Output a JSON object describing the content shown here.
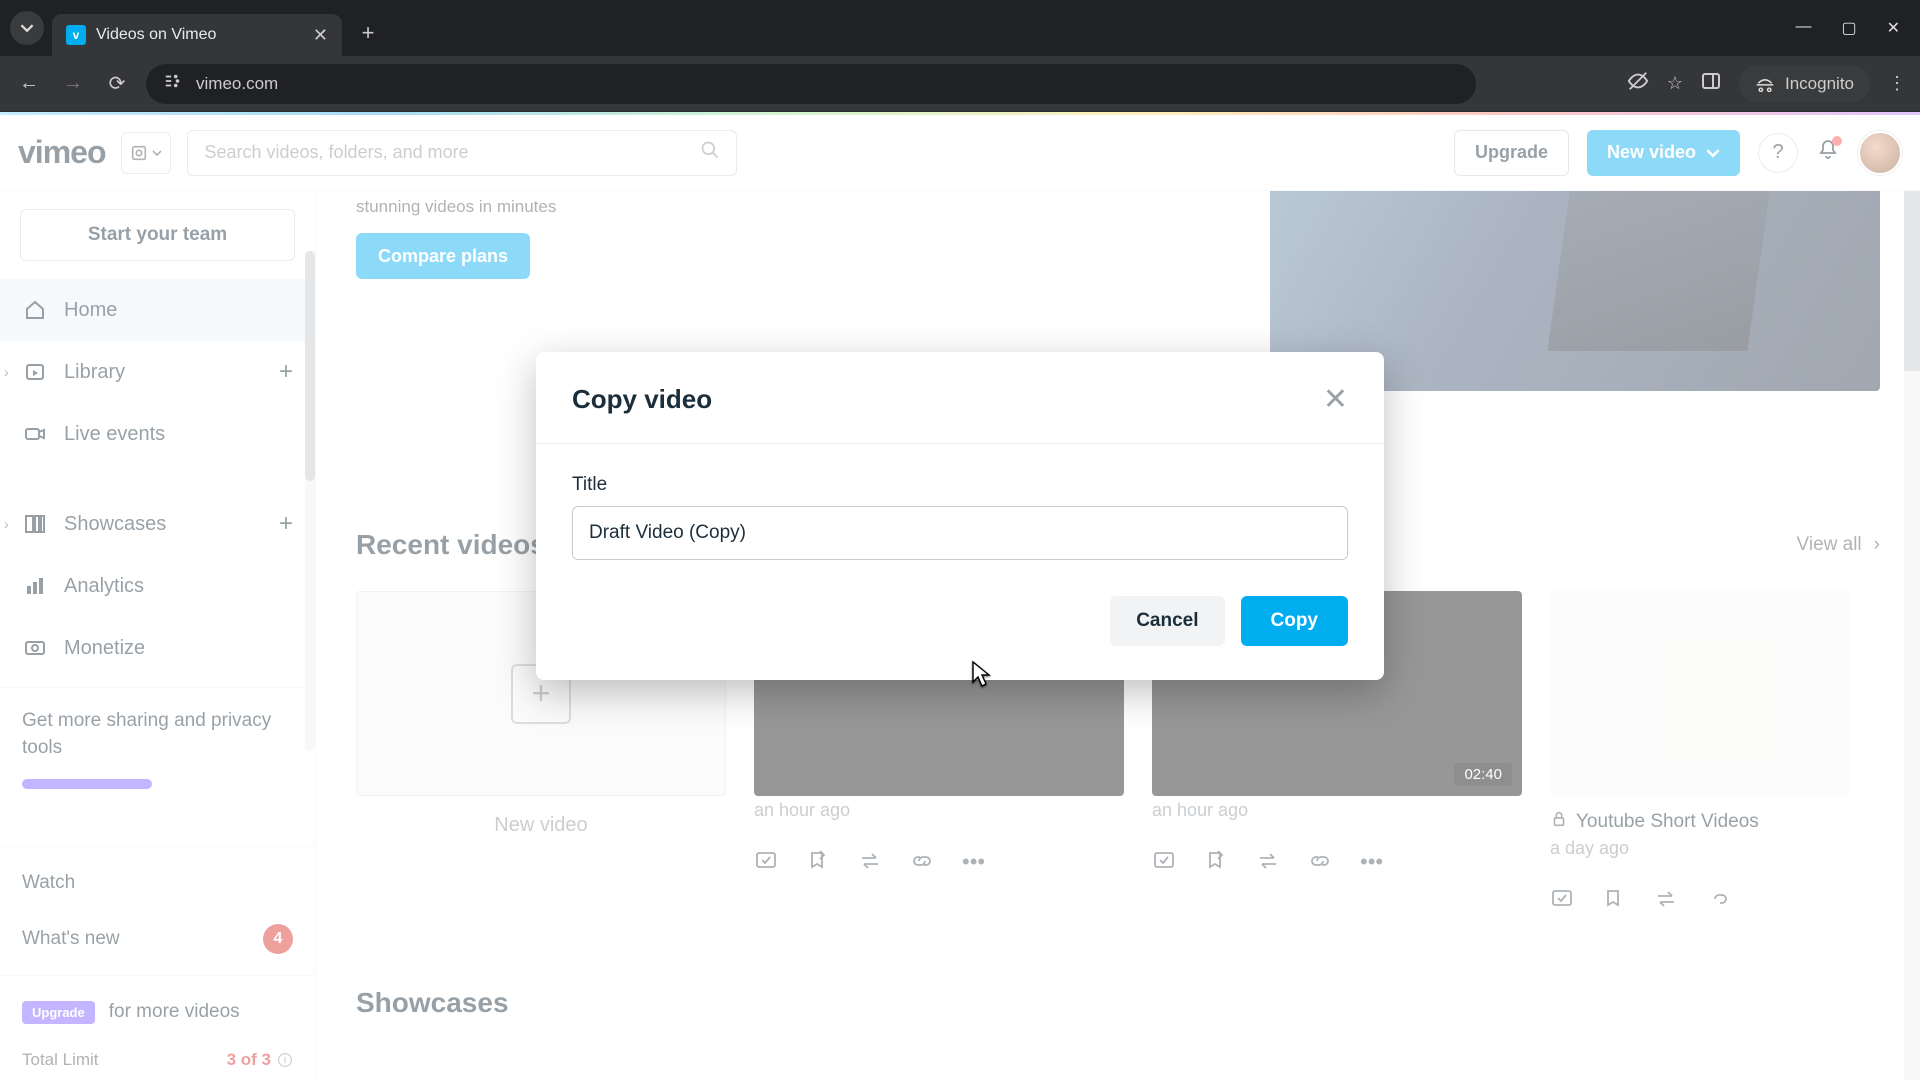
{
  "browser": {
    "tab_title": "Videos on Vimeo",
    "url": "vimeo.com",
    "incognito_label": "Incognito"
  },
  "header": {
    "logo": "vimeo",
    "search_placeholder": "Search videos, folders, and more",
    "upgrade": "Upgrade",
    "new_video": "New video"
  },
  "sidebar": {
    "start_team": "Start your team",
    "items": [
      {
        "label": "Home"
      },
      {
        "label": "Library"
      },
      {
        "label": "Live events"
      },
      {
        "label": "Showcases"
      },
      {
        "label": "Analytics"
      },
      {
        "label": "Monetize"
      }
    ],
    "note": "Get more sharing and privacy tools",
    "watch": "Watch",
    "whats_new": "What's new",
    "whats_new_count": "4",
    "upgrade_pill": "Upgrade",
    "for_more": "for more videos",
    "total_limit_label": "Total Limit",
    "total_limit_value": "3 of 3"
  },
  "banner": {
    "line": "stunning videos in minutes",
    "compare": "Compare plans"
  },
  "recent": {
    "heading": "Recent videos",
    "view_all": "View all",
    "new_label": "New video",
    "cards": [
      {
        "time": "an hour ago"
      },
      {
        "time": "an hour ago",
        "duration": "02:40"
      },
      {
        "title": "Youtube Short Videos",
        "time": "a day ago"
      }
    ]
  },
  "showcases_heading": "Showcases",
  "modal": {
    "title": "Copy video",
    "field_label": "Title",
    "input_value": "Draft Video (Copy)",
    "cancel": "Cancel",
    "copy": "Copy"
  }
}
